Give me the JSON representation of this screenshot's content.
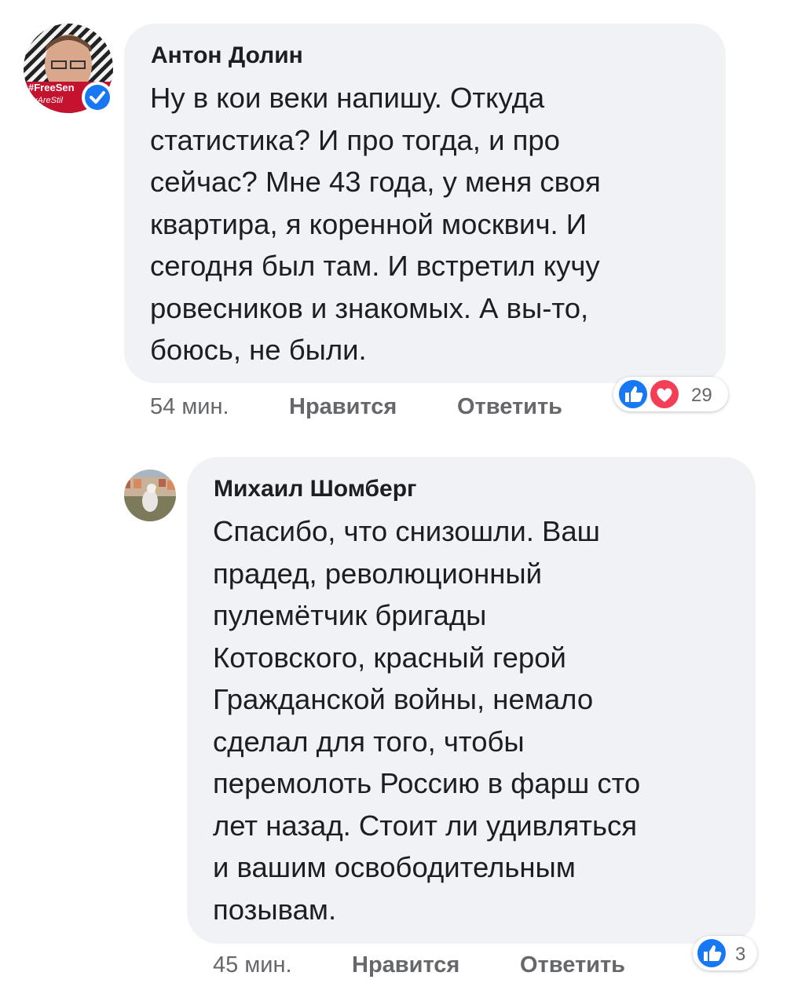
{
  "comments": [
    {
      "author": "Антон Долин",
      "avatar_text_top": "#FreeSen",
      "avatar_text_bottom": "yAreStil",
      "verified": true,
      "text": "Ну в кои веки напишу. Откуда\nстатистика? И про тогда, и про\nсейчас? Мне 43 года, у меня своя\nквартира, я коренной москвич. И\nсегодня был там. И встретил кучу\nровесников и знакомых. А вы-то,\nбоюсь, не были.",
      "time": "54 мин.",
      "like_label": "Нравится",
      "reply_label": "Ответить",
      "reactions": [
        "like-icon",
        "love-icon"
      ],
      "reaction_count": "29",
      "colors": {
        "like": "#1877f2",
        "love": "#f33e58"
      }
    },
    {
      "author": "Михаил Шомберг",
      "text": "Спасибо, что снизошли. Ваш\nпрадед, революционный\nпулемётчик бригады\nКотовского, красный герой\nГражданской войны, немало\nсделал для того, чтобы\nперемолоть Россию в фарш сто\nлет назад. Стоит ли удивляться\nи вашим освободительным\nпозывам.",
      "time": "45 мин.",
      "like_label": "Нравится",
      "reply_label": "Ответить",
      "reactions": [
        "like-icon"
      ],
      "reaction_count": "3",
      "colors": {
        "like": "#1877f2"
      }
    }
  ]
}
